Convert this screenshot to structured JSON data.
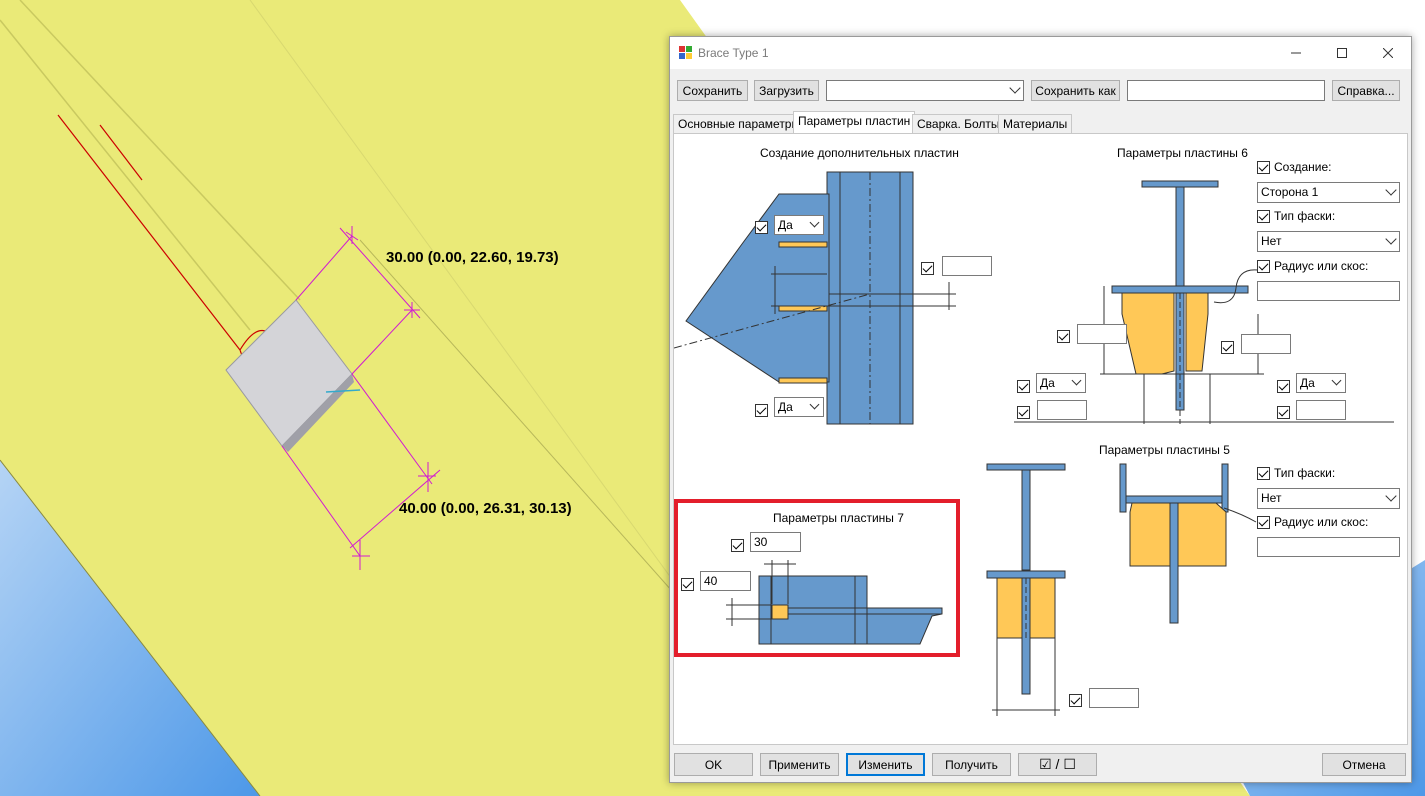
{
  "viewport": {
    "dim_top": "30.00 (0.00, 22.60, 19.73)",
    "dim_bottom": "40.00 (0.00, 26.31, 30.13)"
  },
  "dialog": {
    "title": "Brace Type 1",
    "toolbar": {
      "save": "Сохранить",
      "load": "Загрузить",
      "preset_value": "",
      "save_as": "Сохранить как",
      "save_as_value": "",
      "help": "Справка..."
    },
    "tabs": [
      "Основные параметры",
      "Параметры пластин",
      "Сварка. Болты",
      "Материалы"
    ],
    "sections": {
      "extra_plates": {
        "title": "Создание дополнительных пластин",
        "top_combo": "Да",
        "bottom_combo": "Да",
        "right_value": ""
      },
      "plate6": {
        "title": "Параметры пластины 6",
        "create_label": "Создание:",
        "side_value": "Сторона 1",
        "chamfer_label": "Тип фаски:",
        "chamfer_value": "Нет",
        "radius_label": "Радиус или скос:",
        "radius_value": "",
        "left_value": "",
        "right_value": "",
        "left_combo": "Да",
        "right_combo": "Да",
        "left_bottom_value": "",
        "right_bottom_value": ""
      },
      "plate7": {
        "title": "Параметры пластины 7",
        "top_value": "30",
        "left_value": "40"
      },
      "plate5": {
        "title": "Параметры пластины 5",
        "chamfer_label": "Тип фаски:",
        "chamfer_value": "Нет",
        "radius_label": "Радиус или скос:",
        "radius_value": "",
        "bottom_value": ""
      }
    },
    "buttons": {
      "ok": "OK",
      "apply": "Применить",
      "modify": "Изменить",
      "get": "Получить",
      "toggle": "☑ / ☐",
      "cancel": "Отмена"
    }
  },
  "colors": {
    "model_yellow": "#eaea78",
    "steel_blue": "#6699cc",
    "plate_orange": "#ffc857",
    "dim_magenta": "#d11ad1",
    "highlight_red": "#e31e2b"
  }
}
